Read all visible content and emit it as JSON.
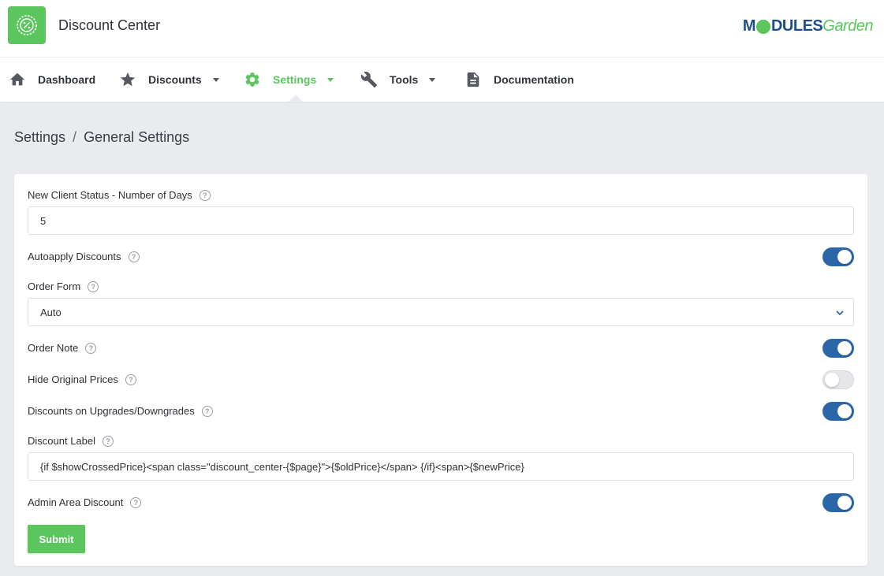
{
  "app": {
    "title": "Discount Center",
    "brand": {
      "part1": "M",
      "part2": "DULES",
      "part3": "Garden"
    }
  },
  "colors": {
    "accent": "#5bc55e",
    "toggle_on": "#2b67a8",
    "background": "#e9ebef"
  },
  "nav": {
    "items": [
      {
        "label": "Dashboard",
        "icon": "home-icon"
      },
      {
        "label": "Discounts",
        "icon": "star-icon"
      },
      {
        "label": "Settings",
        "icon": "gear-icon",
        "active": true
      },
      {
        "label": "Tools",
        "icon": "wrench-icon"
      },
      {
        "label": "Documentation",
        "icon": "document-icon"
      }
    ]
  },
  "breadcrumb": {
    "parent": "Settings",
    "separator": "/",
    "current": "General Settings"
  },
  "form": {
    "new_client_days": {
      "label": "New Client Status - Number of Days",
      "value": "5"
    },
    "autoapply": {
      "label": "Autoapply Discounts",
      "enabled": true
    },
    "order_form": {
      "label": "Order Form",
      "value": "Auto"
    },
    "order_note": {
      "label": "Order Note",
      "enabled": true
    },
    "hide_original": {
      "label": "Hide Original Prices",
      "enabled": false
    },
    "upgrades": {
      "label": "Discounts on Upgrades/Downgrades",
      "enabled": true
    },
    "discount_label": {
      "label": "Discount Label",
      "value": "{if $showCrossedPrice}<span class=\"discount_center-{$page}\">{$oldPrice}</span> {/if}<span>{$newPrice}"
    },
    "admin_area": {
      "label": "Admin Area Discount",
      "enabled": true
    },
    "help_glyph": "?",
    "submit_label": "Submit"
  }
}
